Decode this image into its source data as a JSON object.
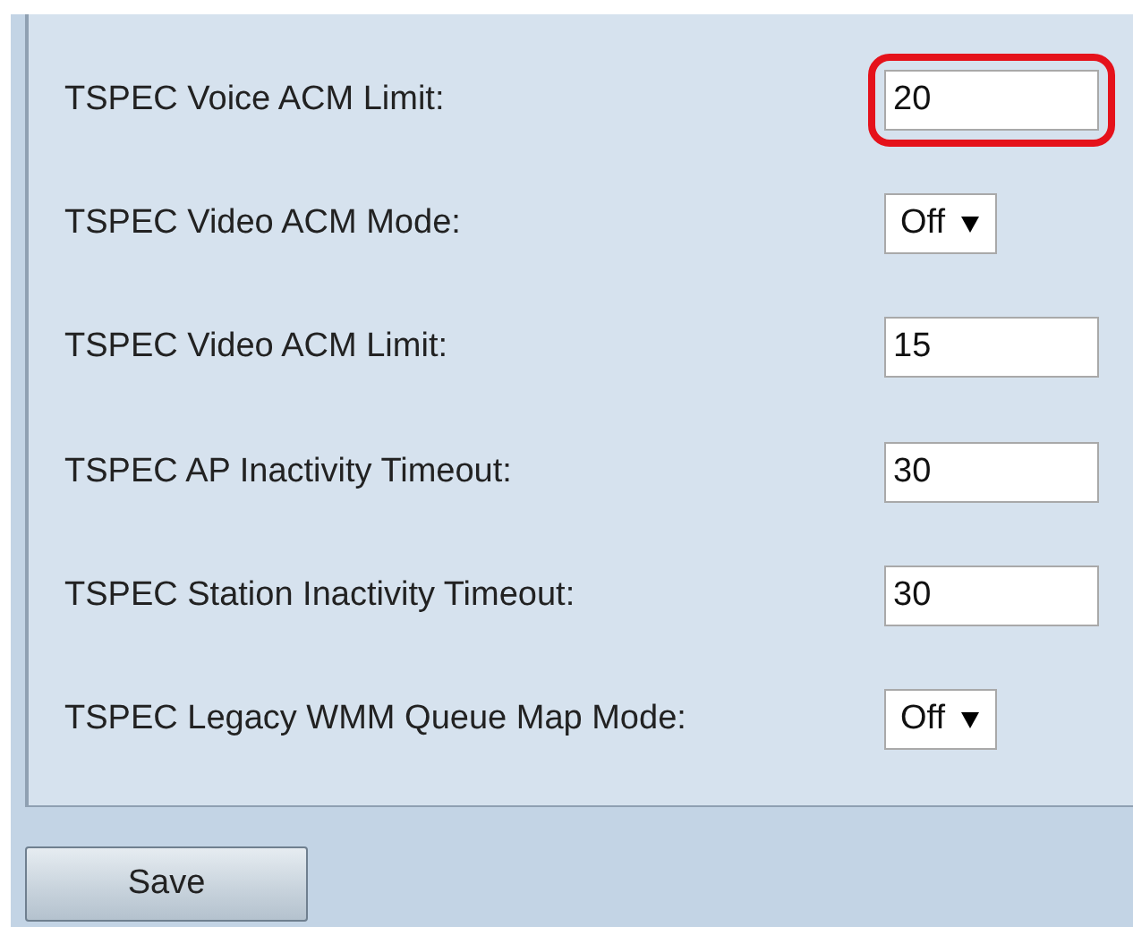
{
  "settings": [
    {
      "label": "TSPEC Voice ACM Limit:",
      "kind": "text",
      "value": "20",
      "highlighted": true
    },
    {
      "label": "TSPEC Video ACM Mode:",
      "kind": "select",
      "value": "Off",
      "highlighted": false
    },
    {
      "label": "TSPEC Video ACM Limit:",
      "kind": "text",
      "value": "15",
      "highlighted": false
    },
    {
      "label": "TSPEC AP Inactivity Timeout:",
      "kind": "text",
      "value": "30",
      "highlighted": false
    },
    {
      "label": "TSPEC Station Inactivity Timeout:",
      "kind": "text",
      "value": "30",
      "highlighted": false
    },
    {
      "label": "TSPEC Legacy WMM Queue Map Mode:",
      "kind": "select",
      "value": "Off",
      "highlighted": false
    }
  ],
  "save_button": "Save"
}
